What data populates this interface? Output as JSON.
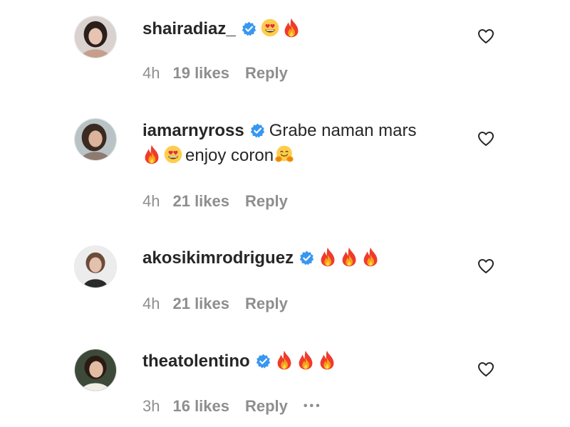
{
  "comments": [
    {
      "username": "shairadiaz_",
      "verified": true,
      "text": "",
      "emoji": [
        "heart-eyes-emoji",
        "fire-emoji"
      ],
      "time": "4h",
      "likes": "19 likes",
      "reply": "Reply"
    },
    {
      "username": "iamarnyross",
      "verified": true,
      "text_line1": "Grabe naman mars",
      "text_line2": "enjoy coron",
      "emoji": [
        "fire-emoji",
        "heart-eyes-emoji",
        "hugging-emoji"
      ],
      "time": "4h",
      "likes": "21 likes",
      "reply": "Reply"
    },
    {
      "username": "akosikimrodriguez",
      "verified": true,
      "text": "",
      "emoji": [
        "fire-emoji",
        "fire-emoji",
        "fire-emoji"
      ],
      "time": "4h",
      "likes": "21 likes",
      "reply": "Reply"
    },
    {
      "username": "theatolentino",
      "verified": true,
      "text": "",
      "emoji": [
        "fire-emoji",
        "fire-emoji",
        "fire-emoji"
      ],
      "time": "3h",
      "likes": "16 likes",
      "reply": "Reply",
      "more": "•••"
    }
  ],
  "colors": {
    "verified": "#3897f0",
    "meta": "#8e8e8e",
    "text": "#262626"
  }
}
